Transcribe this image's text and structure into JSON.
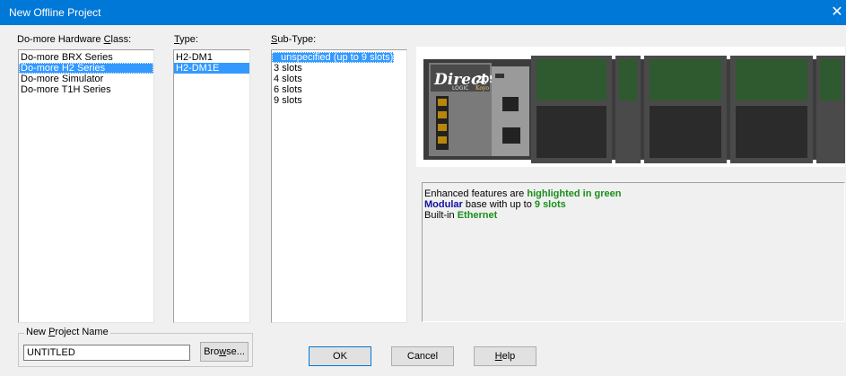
{
  "window": {
    "title": "New Offline Project",
    "close": "✕"
  },
  "hardware_class": {
    "label_pre": "Do-more Hardware ",
    "label_ul": "C",
    "label_post": "lass:",
    "items": [
      "Do-more BRX Series",
      "Do-more H2 Series",
      "Do-more Simulator",
      "Do-more T1H Series"
    ],
    "selected_index": 1
  },
  "type": {
    "label_ul": "T",
    "label_post": "ype:",
    "items": [
      "H2-DM1",
      "H2-DM1E"
    ],
    "selected_index": 1
  },
  "subtype": {
    "label_ul": "S",
    "label_post": "ub-Type:",
    "items": [
      "unspecified (up to 9 slots)",
      "3 slots",
      "4 slots",
      "6 slots",
      "9 slots"
    ],
    "selected_index": 0
  },
  "preview": {
    "brand_text": "Direct",
    "brand_sub": "LOGIC",
    "model": "205",
    "maker": "Koyo"
  },
  "description": {
    "line1_pre": "Enhanced features are ",
    "line1_hl": "highlighted in green",
    "line2_hl1": "Modular",
    "line2_mid": " base with up to ",
    "line2_hl2": "9 slots",
    "line3_pre": "Built-in ",
    "line3_hl": "Ethernet"
  },
  "project_name": {
    "label_pre": "New ",
    "label_ul": "P",
    "label_post": "roject Name",
    "value": "UNTITLED",
    "browse_pre": "Bro",
    "browse_ul": "w",
    "browse_post": "se..."
  },
  "buttons": {
    "ok": "OK",
    "cancel": "Cancel",
    "help_ul": "H",
    "help_post": "elp"
  },
  "colors": {
    "titlebar": "#0078d7",
    "selection": "#3399ff",
    "highlight_green": "#1a8f1a",
    "highlight_blue": "#1010a0"
  }
}
